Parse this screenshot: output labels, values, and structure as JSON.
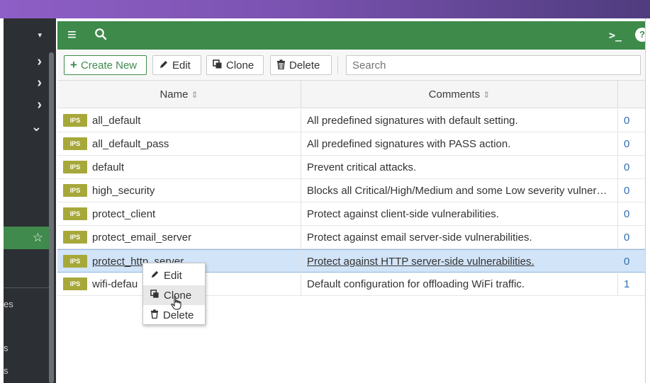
{
  "sidebar": {
    "rows": [
      {
        "icon": "chevron-down-icon",
        "glyph": "▾"
      },
      {
        "icon": "chevron-right-icon",
        "glyph": "›"
      },
      {
        "icon": "chevron-right-icon",
        "glyph": "›"
      },
      {
        "icon": "chevron-right-icon",
        "glyph": "›"
      },
      {
        "icon": "chevron-down-icon",
        "glyph": "⌄"
      }
    ],
    "active_star": "☆",
    "fragments": [
      "es",
      "s",
      "s"
    ]
  },
  "header": {
    "menu_glyph": "≡",
    "search_glyph": "⌕",
    "cli_glyph": ">_",
    "help_glyph": "?"
  },
  "toolbar": {
    "create_label": "Create New",
    "edit_label": "Edit",
    "clone_label": "Clone",
    "delete_label": "Delete",
    "search_placeholder": "Search"
  },
  "table": {
    "headers": [
      "Name",
      "Comments"
    ],
    "sort_glyph": "⇕",
    "badge": "IPS",
    "rows": [
      {
        "name": "all_default",
        "comment": "All predefined signatures with default setting.",
        "ref": "0"
      },
      {
        "name": "all_default_pass",
        "comment": "All predefined signatures with PASS action.",
        "ref": "0"
      },
      {
        "name": "default",
        "comment": "Prevent critical attacks.",
        "ref": "0"
      },
      {
        "name": "high_security",
        "comment": "Blocks all Critical/High/Medium and some Low severity vulner…",
        "ref": "0"
      },
      {
        "name": "protect_client",
        "comment": "Protect against client-side vulnerabilities.",
        "ref": "0"
      },
      {
        "name": "protect_email_server",
        "comment": "Protect against email server-side vulnerabilities.",
        "ref": "0"
      },
      {
        "name": "protect_http_server",
        "comment": "Protect against HTTP server-side vulnerabilities.",
        "ref": "0",
        "selected": true
      },
      {
        "name": "wifi-defau",
        "comment": "Default configuration for offloading WiFi traffic.",
        "ref": "1"
      }
    ]
  },
  "context_menu": {
    "items": [
      {
        "label": "Edit",
        "icon": "pencil-icon"
      },
      {
        "label": "Clone",
        "icon": "clone-icon",
        "hover": true
      },
      {
        "label": "Delete",
        "icon": "trash-icon"
      }
    ]
  },
  "colors": {
    "brand_green": "#3d8a4b",
    "sidebar_bg": "#2c2f33",
    "badge_olive": "#a7a83a",
    "selected_row": "#d2e4f7",
    "link_blue": "#2f6fae"
  }
}
